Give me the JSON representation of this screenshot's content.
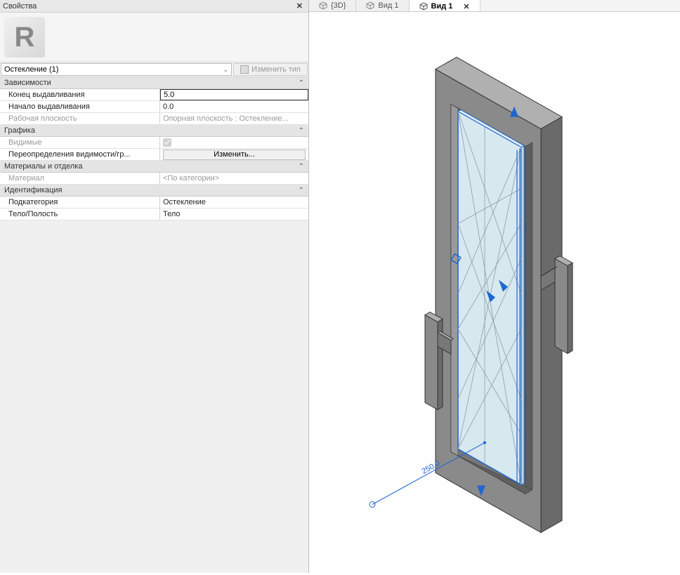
{
  "panel": {
    "title": "Свойства",
    "logo_letter": "R",
    "type_selector": "Остекление (1)",
    "edit_type_label": "Изменить тип"
  },
  "groups": {
    "dependencies": {
      "title": "Зависимости",
      "extrude_end_label": "Конец выдавливания",
      "extrude_end_value": "5.0",
      "extrude_start_label": "Начало выдавливания",
      "extrude_start_value": "0.0",
      "workplane_label": "Рабочая плоскость",
      "workplane_value": "Опорная плоскость : Остекление..."
    },
    "graphics": {
      "title": "Графика",
      "visible_label": "Видимые",
      "visible_checked": true,
      "override_label": "Переопределения видимости/гр...",
      "override_button": "Изменить..."
    },
    "materials": {
      "title": "Материалы и отделка",
      "material_label": "Материал",
      "material_value": "<По категории>"
    },
    "identity": {
      "title": "Идентификация",
      "subcat_label": "Подкатегория",
      "subcat_value": "Остекление",
      "solidvoid_label": "Тело/Полость",
      "solidvoid_value": "Тело"
    }
  },
  "tabs": [
    {
      "label": "{3D}",
      "active": false
    },
    {
      "label": "Вид 1",
      "active": false
    },
    {
      "label": "Вид 1",
      "active": true
    }
  ],
  "dimension_text": "250.0"
}
